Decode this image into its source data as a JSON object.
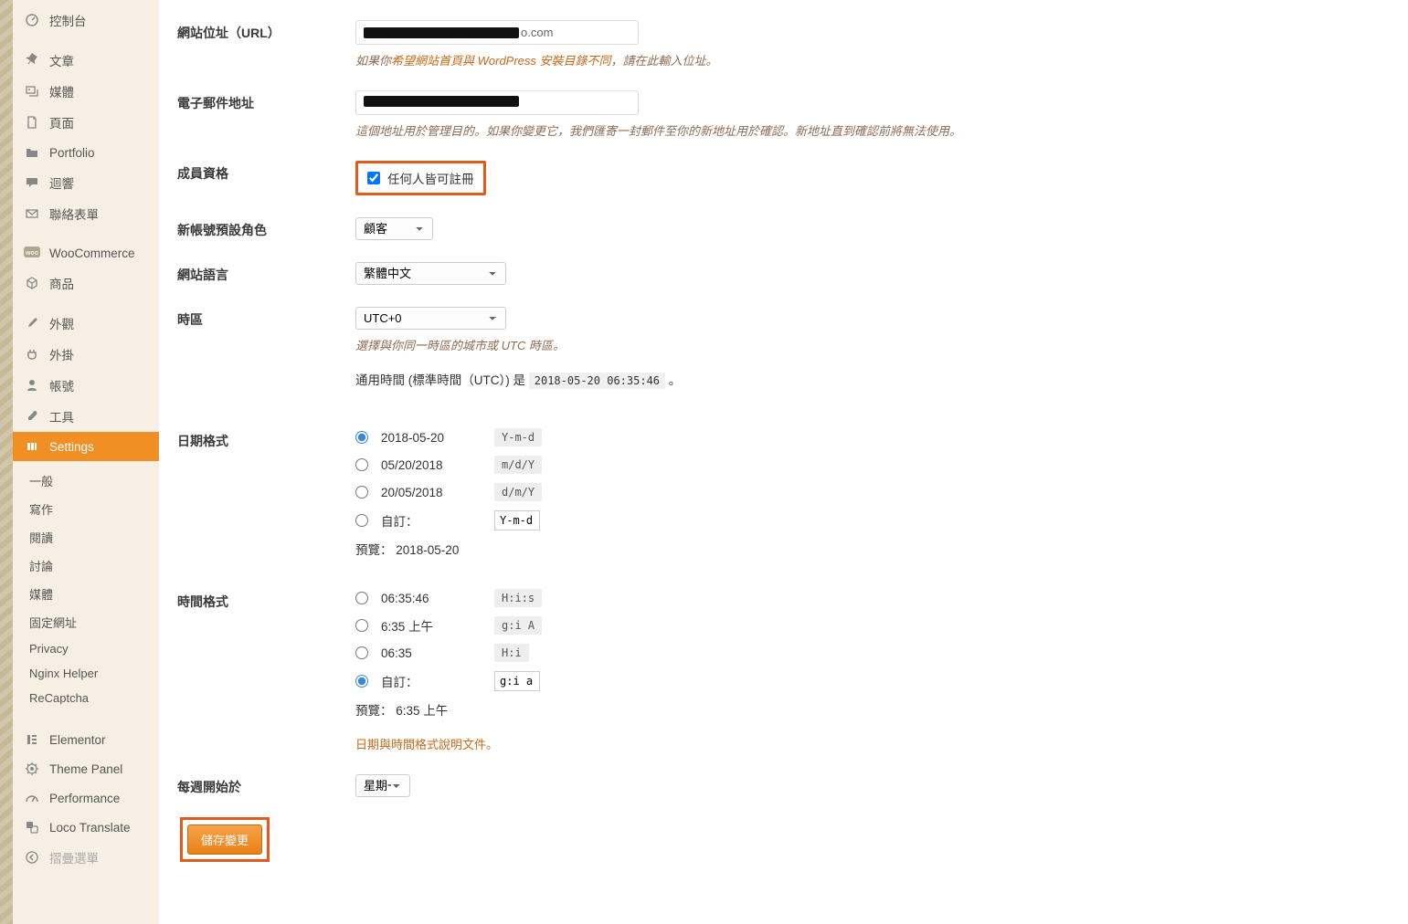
{
  "sidebar": {
    "items": [
      {
        "label": "控制台",
        "icon": "dashboard-icon"
      },
      {
        "label": "文章",
        "icon": "pin-icon"
      },
      {
        "label": "媒體",
        "icon": "media-icon"
      },
      {
        "label": "頁面",
        "icon": "page-icon"
      },
      {
        "label": "Portfolio",
        "icon": "folder-icon"
      },
      {
        "label": "迴響",
        "icon": "comment-icon"
      },
      {
        "label": "聯絡表單",
        "icon": "mail-icon"
      },
      {
        "label": "WooCommerce",
        "icon": "woo-icon"
      },
      {
        "label": "商品",
        "icon": "product-icon"
      },
      {
        "label": "外觀",
        "icon": "brush-icon"
      },
      {
        "label": "外掛",
        "icon": "plugin-icon"
      },
      {
        "label": "帳號",
        "icon": "user-icon"
      },
      {
        "label": "工具",
        "icon": "wrench-icon"
      },
      {
        "label": "Settings",
        "icon": "settings-icon"
      },
      {
        "label": "Elementor",
        "icon": "elementor-icon"
      },
      {
        "label": "Theme Panel",
        "icon": "gear-icon"
      },
      {
        "label": "Performance",
        "icon": "gauge-icon"
      },
      {
        "label": "Loco Translate",
        "icon": "translate-icon"
      },
      {
        "label": "摺疊選單",
        "icon": "collapse-icon"
      }
    ],
    "submenu": [
      "一般",
      "寫作",
      "閱讀",
      "討論",
      "媒體",
      "固定網址",
      "Privacy",
      "Nginx Helper",
      "ReCaptcha"
    ]
  },
  "form": {
    "site_url": {
      "label": "網站位址（URL）",
      "suffix": "o.com",
      "desc_pre": "如果你",
      "desc_link": "希望網站首頁與 WordPress 安裝目錄不同",
      "desc_post": "，請在此輸入位址。"
    },
    "email": {
      "label": "電子郵件地址",
      "desc": "這個地址用於管理目的。如果你變更它，我們匯寄一封郵件至你的新地址用於確認。新地址直到確認前將無法使用。"
    },
    "membership": {
      "label": "成員資格",
      "checkbox": "任何人皆可註冊"
    },
    "default_role": {
      "label": "新帳號預設角色",
      "value": "顧客"
    },
    "site_lang": {
      "label": "網站語言",
      "value": "繁體中文"
    },
    "timezone": {
      "label": "時區",
      "value": "UTC+0",
      "desc": "選擇與你同一時區的城市或 UTC 時區。",
      "utc_pre": "通用時間 (標準時間（UTC）) 是 ",
      "utc_val": "2018-05-20 06:35:46",
      "utc_post": " 。"
    },
    "date_format": {
      "label": "日期格式",
      "opts": [
        {
          "display": "2018-05-20",
          "code": "Y-m-d",
          "checked": true
        },
        {
          "display": "05/20/2018",
          "code": "m/d/Y"
        },
        {
          "display": "20/05/2018",
          "code": "d/m/Y"
        }
      ],
      "custom_label": "自訂：",
      "custom_val": "Y-m-d",
      "preview_label": "預覽：",
      "preview_val": "2018-05-20"
    },
    "time_format": {
      "label": "時間格式",
      "opts": [
        {
          "display": "06:35:46",
          "code": "H:i:s"
        },
        {
          "display": "6:35 上午",
          "code": "g:i A"
        },
        {
          "display": "06:35",
          "code": "H:i"
        }
      ],
      "custom_label": "自訂：",
      "custom_val": "g:i a",
      "preview_label": "預覽：",
      "preview_val": "6:35 上午",
      "docs_link": "日期與時間格式說明文件。"
    },
    "week_start": {
      "label": "每週開始於",
      "value": "星期一"
    },
    "submit": "儲存變更"
  }
}
